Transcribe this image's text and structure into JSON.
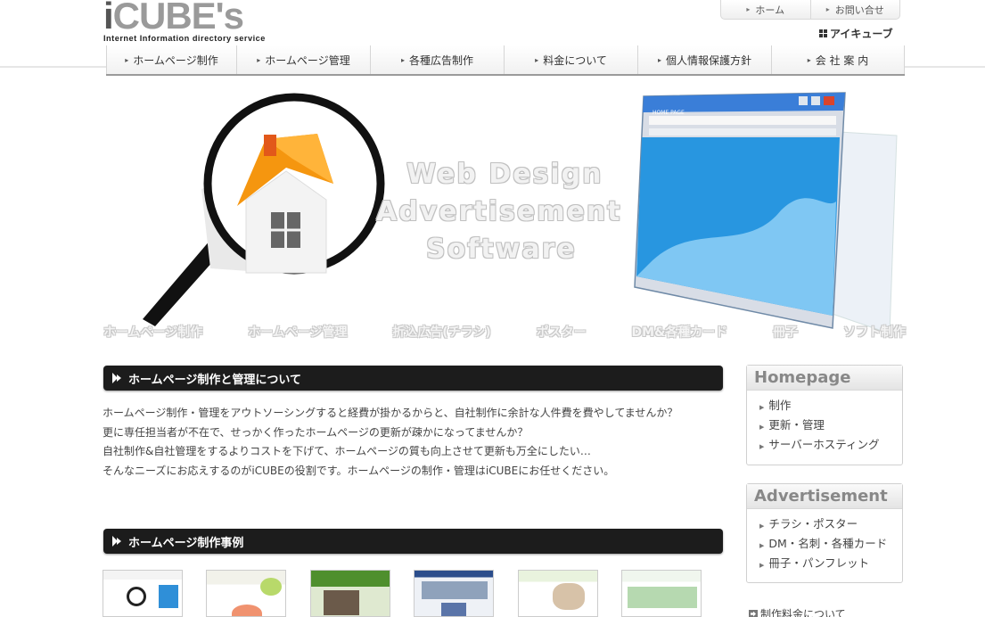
{
  "header": {
    "logo_text": "iCUBE's",
    "logo_tagline": "Internet Information directory service",
    "top_links": [
      "ホーム",
      "お問い合せ"
    ],
    "brand_name": "アイキューブ"
  },
  "nav": {
    "items": [
      "ホームページ制作",
      "ホームページ管理",
      "各種広告制作",
      "料金について",
      "個人情報保護方針",
      "会 社 案 内"
    ]
  },
  "hero": {
    "lines": [
      "Web Design",
      "Advertisement",
      "Software"
    ],
    "browser_title": "HOME PAGE",
    "categories": [
      "ホームページ制作",
      "ホームページ管理",
      "折込広告(チラシ)",
      "ポスター",
      "DM&各種カード",
      "冊子",
      "ソフト制作"
    ]
  },
  "main": {
    "section1_title": "ホームページ制作と管理について",
    "intro_lines": [
      "ホームページ制作・管理をアウトソーシングすると経費が掛かるからと、自社制作に余計な人件費を費やしてませんか？",
      "更に専任担当者が不在で、せっかく作ったホームページの更新が疎かになってませんか？",
      "自社制作&自社管理をするよりコストを下げて、ホームページの質も向上させて更新も万全にしたい…",
      "そんなニーズにお応えするのがiCUBEの役割です。ホームページの制作・管理はiCUBEにお任せください。"
    ],
    "section2_title": "ホームページ制作事例"
  },
  "sidebar": {
    "homepage": {
      "title": "Homepage",
      "items": [
        "制作",
        "更新・管理",
        "サーバーホスティング"
      ]
    },
    "advertisement": {
      "title": "Advertisement",
      "items": [
        "チラシ・ポスター",
        "DM・名刺・各種カード",
        "冊子・パンフレット"
      ]
    },
    "price_link": "制作料金について"
  },
  "colors": {
    "section_bar": "#1c1c1c",
    "roof_orange": "#f5960f",
    "browser_blue": "#1f8fd8",
    "accent_red": "#d0312d"
  }
}
